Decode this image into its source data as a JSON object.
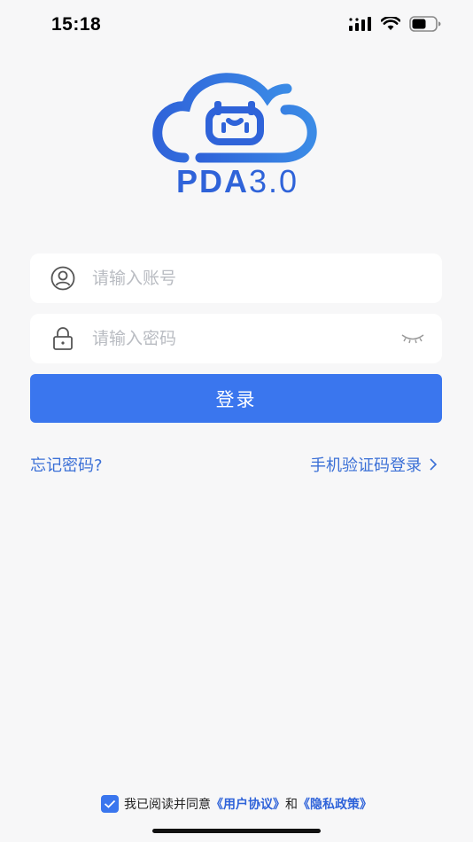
{
  "status_bar": {
    "time": "15:18"
  },
  "logo": {
    "text_bold": "PDA",
    "text_version": "3.0",
    "brand_color": "#2f63d9"
  },
  "form": {
    "account_placeholder": "请输入账号",
    "password_placeholder": "请输入密码",
    "account_icon": "user-icon",
    "password_icon": "lock-icon",
    "toggle_icon": "eye-closed-icon",
    "login_label": "登录"
  },
  "links": {
    "forgot_password": "忘记密码?",
    "sms_login": "手机验证码登录",
    "sms_icon": "chevron-right-icon"
  },
  "agreement": {
    "checked": true,
    "prefix": "我已阅读并同意",
    "user_agreement": "《用户协议》",
    "conjunction": "和",
    "privacy_policy": "《隐私政策》"
  },
  "colors": {
    "accent": "#3a76ee",
    "link": "#3a6fd6",
    "background": "#f7f7f8"
  }
}
